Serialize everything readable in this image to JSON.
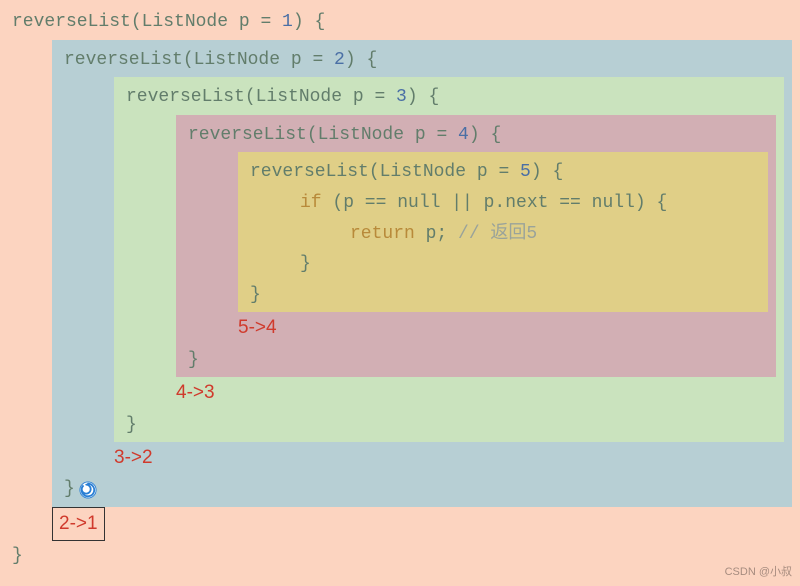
{
  "level0": {
    "sig_a": "reverseList(ListNode p = ",
    "num": "1",
    "sig_b": ") {",
    "close": "}"
  },
  "level1": {
    "sig_a": "reverseList(ListNode p = ",
    "num": "2",
    "sig_b": ") {",
    "result": "3->2",
    "close": "}"
  },
  "level2": {
    "sig_a": "reverseList(ListNode p = ",
    "num": "3",
    "sig_b": ") {",
    "result": "4->3",
    "close": "}"
  },
  "level3": {
    "sig_a": "reverseList(ListNode p = ",
    "num": "4",
    "sig_b": ") {",
    "result": "5->4",
    "close": "}"
  },
  "level4": {
    "sig_a": "reverseList(ListNode p = ",
    "num": "5",
    "sig_b": ") {",
    "if_kw": "if ",
    "if_cond": "(p == null || p.next == null) {",
    "ret_kw": "return ",
    "ret_var": "p; ",
    "comment": "// 返回5",
    "if_close": "}",
    "close": "}"
  },
  "final_result": "2->1",
  "watermark": "CSDN @小叔"
}
